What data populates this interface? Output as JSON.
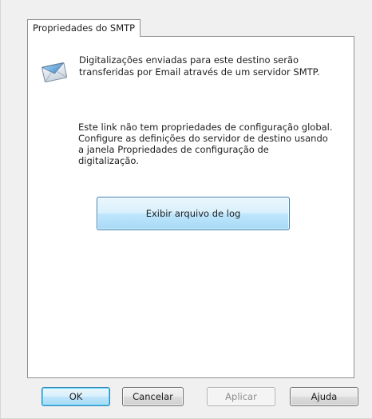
{
  "tab": {
    "label": "Propriedades do SMTP"
  },
  "panel": {
    "icon": "email-envelope-icon",
    "description": "Digitalizações enviadas para este destino serão\ntransferidas por Email através de um servidor SMTP.",
    "note": "Este link não tem propriedades de configuração global.\nConfigure as definições do servidor de destino usando\na janela Propriedades de configuração de\ndigitalização.",
    "log_button": "Exibir arquivo de log"
  },
  "buttons": {
    "ok": "OK",
    "cancel": "Cancelar",
    "apply": "Aplicar",
    "help": "Ajuda"
  },
  "colors": {
    "dialog_background": "#f0f0f0",
    "panel_background": "#ffffff",
    "default_button_border": "#3c7fb1",
    "disabled_text": "#8d8d8d"
  }
}
